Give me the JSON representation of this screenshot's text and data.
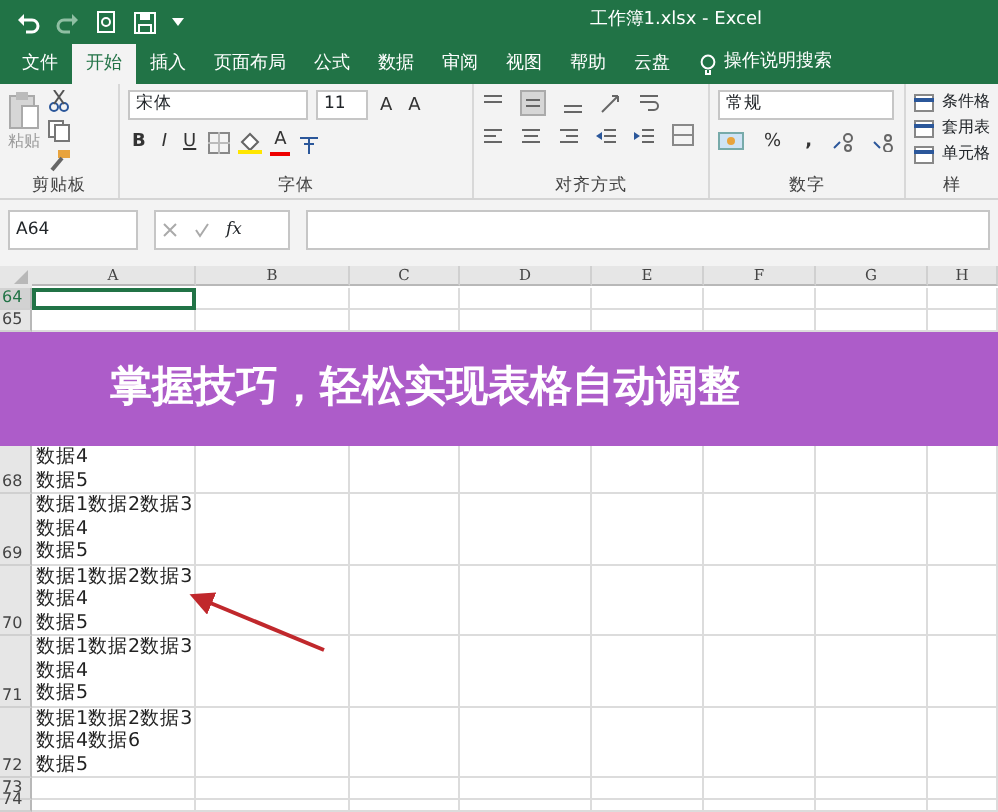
{
  "title_bar": {
    "title": "工作簿1.xlsx  -  Excel"
  },
  "tabs": [
    {
      "label": "文件",
      "selected": false
    },
    {
      "label": "开始",
      "selected": true
    },
    {
      "label": "插入",
      "selected": false
    },
    {
      "label": "页面布局",
      "selected": false
    },
    {
      "label": "公式",
      "selected": false
    },
    {
      "label": "数据",
      "selected": false
    },
    {
      "label": "审阅",
      "selected": false
    },
    {
      "label": "视图",
      "selected": false
    },
    {
      "label": "帮助",
      "selected": false
    },
    {
      "label": "云盘",
      "selected": false
    }
  ],
  "tell_me": "操作说明搜索",
  "ribbon": {
    "clipboard": {
      "paste_label": "粘贴",
      "group_label": "剪贴板"
    },
    "font": {
      "name": "宋体",
      "size": "11",
      "bold": "B",
      "italic": "I",
      "underline": "U",
      "font_color": "A",
      "grow": "A",
      "shrink": "A",
      "group_label": "字体"
    },
    "alignment": {
      "group_label": "对齐方式"
    },
    "number": {
      "format": "常规",
      "percent": "%",
      "comma": ",",
      "group_label": "数字"
    },
    "styles": {
      "items": [
        "条件格",
        "套用表",
        "单元格"
      ],
      "group_label": "样"
    }
  },
  "formula_bar": {
    "name_box": "A64",
    "function_label": "fx"
  },
  "columns": [
    "A",
    "B",
    "C",
    "D",
    "E",
    "F",
    "G",
    "H"
  ],
  "rows_above_banner": [
    {
      "number": "64",
      "selected": true
    },
    {
      "number": "65",
      "selected": false
    }
  ],
  "rows": [
    {
      "number": "68",
      "selected": false,
      "lines": [
        "数据4",
        "数据5"
      ]
    },
    {
      "number": "69",
      "selected": false,
      "lines": [
        "数据1数据2数据3",
        "数据4",
        "数据5"
      ]
    },
    {
      "number": "70",
      "selected": false,
      "lines": [
        "数据1数据2数据3",
        "数据4",
        "数据5"
      ]
    },
    {
      "number": "71",
      "selected": false,
      "lines": [
        "数据1数据2数据3",
        "数据4",
        "数据5"
      ]
    },
    {
      "number": "72",
      "selected": false,
      "lines": [
        "数据1数据2数据3",
        "数据4数据6",
        "数据5"
      ]
    },
    {
      "number": "73",
      "selected": false
    },
    {
      "number": "74",
      "selected": false
    }
  ],
  "banner": "掌握技巧，轻松实现表格自动调整"
}
